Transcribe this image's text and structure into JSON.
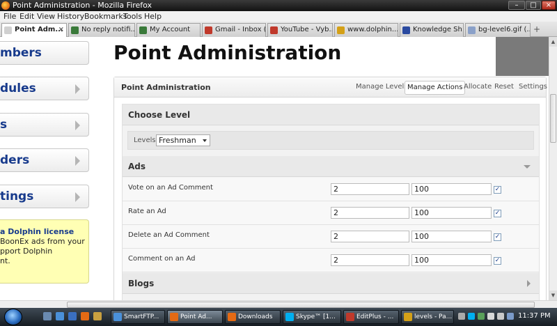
{
  "window": {
    "title": "Point Administration - Mozilla Firefox",
    "min": "–",
    "max": "□",
    "close": "×"
  },
  "menu": [
    "File",
    "Edit",
    "View",
    "History",
    "Bookmarks",
    "Tools",
    "Help"
  ],
  "tabs": [
    {
      "label": "Point Adm...",
      "close": "×",
      "color": "#d0d0d0"
    },
    {
      "label": "No reply notifi...",
      "color": "#3a7a3a"
    },
    {
      "label": "My Account",
      "color": "#3a7a3a"
    },
    {
      "label": "Gmail - Inbox (...",
      "color": "#c0392b"
    },
    {
      "label": "YouTube - Vyb...",
      "color": "#c0392b"
    },
    {
      "label": "www.dolphin...",
      "color": "#d4a017"
    },
    {
      "label": "Knowledge Sh...",
      "color": "#2a4aa0"
    },
    {
      "label": "bg-level6.gif (...",
      "color": "#8aa0c8"
    }
  ],
  "new_tab": "+",
  "left_nav": [
    {
      "label": "mbers"
    },
    {
      "label": "dules"
    },
    {
      "label": "s"
    },
    {
      "label": "ders"
    },
    {
      "label": "tings"
    }
  ],
  "promo": {
    "title": "a Dolphin license",
    "lines": [
      "BoonEx ads from your",
      "pport Dolphin",
      "nt."
    ]
  },
  "page_title": "Point Administration",
  "panel": {
    "title": "Point Administration",
    "tabs": [
      "Manage Levels",
      "Manage Actions",
      "Allocate",
      "Reset",
      "Settings"
    ],
    "active_tab": "Manage Actions"
  },
  "choose_level": {
    "heading": "Choose Level",
    "label": "Levels",
    "selected": "Freshman"
  },
  "sections": [
    {
      "heading": "Ads",
      "rows": [
        {
          "label": "Vote on an Ad Comment",
          "points": "2",
          "limit": "100",
          "checked": "✓"
        },
        {
          "label": "Rate an Ad",
          "points": "2",
          "limit": "100",
          "checked": "✓"
        },
        {
          "label": "Delete an Ad Comment",
          "points": "2",
          "limit": "100",
          "checked": "✓"
        },
        {
          "label": "Comment on an Ad",
          "points": "2",
          "limit": "100",
          "checked": "✓"
        }
      ]
    },
    {
      "heading": "Blogs"
    }
  ],
  "taskbar": {
    "buttons": [
      {
        "label": "SmartFTP...",
        "color": "#4a90d9"
      },
      {
        "label": "Point Ad...",
        "color": "#e46a14"
      },
      {
        "label": "Downloads",
        "color": "#e46a14"
      },
      {
        "label": "Skype™ [1...",
        "color": "#00aff0"
      },
      {
        "label": "EditPlus - ...",
        "color": "#c0392b"
      },
      {
        "label": "levels - Pa...",
        "color": "#d4a017"
      }
    ],
    "clock": "11:37 PM"
  }
}
